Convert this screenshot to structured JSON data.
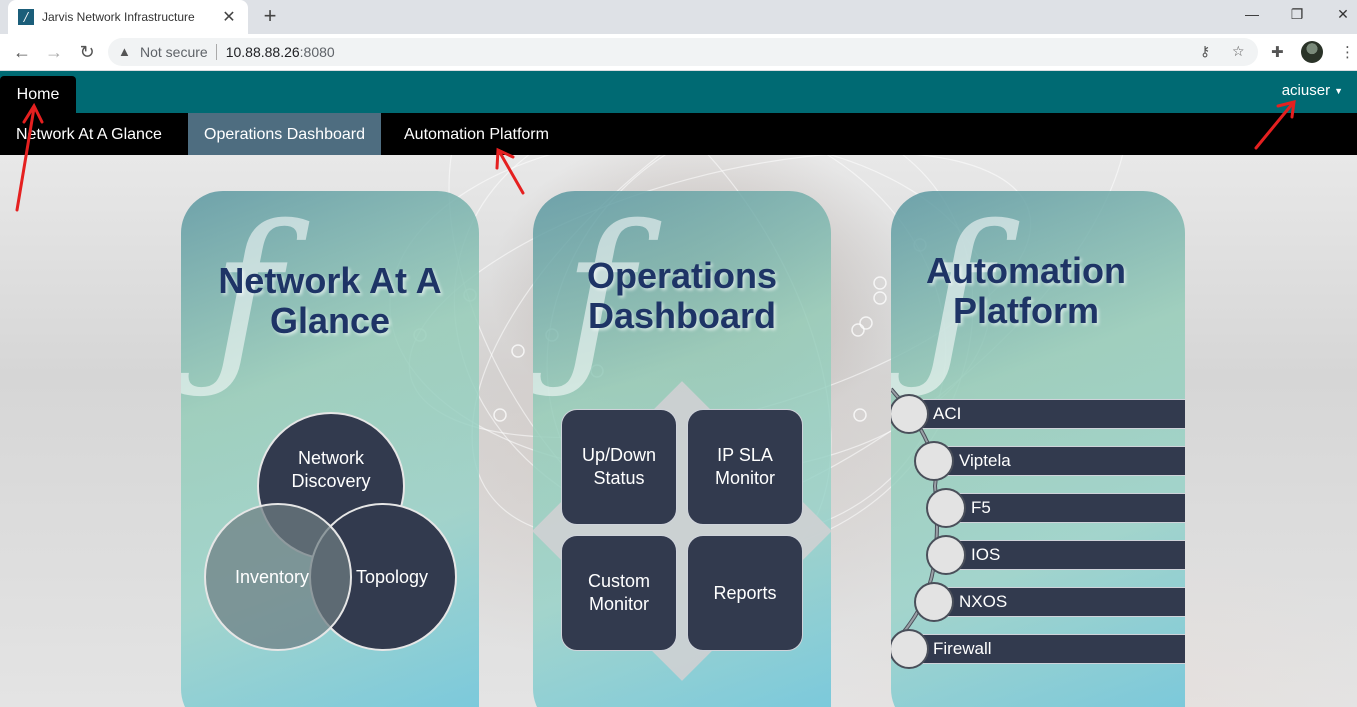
{
  "browser": {
    "tab_title": "Jarvis Network Infrastructure",
    "tab_close": "✕",
    "new_tab": "+",
    "security_label": "Not secure",
    "url_host": "10.88.88.26",
    "url_port": ":8080",
    "window_controls": {
      "minimize": "—",
      "maximize": "❐",
      "close": "✕"
    },
    "icons": [
      "back-arrow-icon",
      "forward-arrow-icon",
      "reload-icon",
      "warning-icon",
      "key-icon",
      "star-icon",
      "extensions-icon",
      "profile-avatar",
      "more-icon"
    ]
  },
  "app": {
    "home_tab": "Home",
    "user_menu": "aciuser",
    "nav": [
      {
        "label": "Network At A Glance"
      },
      {
        "label": "Operations Dashboard"
      },
      {
        "label": "Automation Platform"
      }
    ],
    "colors": {
      "header_teal": "#006a73",
      "nav_black": "#000000",
      "nav_active": "#4e6d80",
      "tile_navy": "#323a4e",
      "title_navy": "#1e3466"
    }
  },
  "cards": {
    "network": {
      "title_line1": "Network At A",
      "title_line2": "Glance",
      "venn": {
        "discovery_l1": "Network",
        "discovery_l2": "Discovery",
        "inventory": "Inventory",
        "topology": "Topology"
      }
    },
    "operations": {
      "title_line1": "Operations",
      "title_line2": "Dashboard",
      "tiles": {
        "updown_l1": "Up/Down",
        "updown_l2": "Status",
        "ipsla_l1": "IP SLA",
        "ipsla_l2": "Monitor",
        "custom_l1": "Custom",
        "custom_l2": "Monitor",
        "reports": "Reports"
      }
    },
    "automation": {
      "title_line1": "Automation",
      "title_line2": "Platform",
      "items": [
        {
          "label": "ACI"
        },
        {
          "label": "Viptela"
        },
        {
          "label": "F5"
        },
        {
          "label": "IOS"
        },
        {
          "label": "NXOS"
        },
        {
          "label": "Firewall"
        }
      ]
    }
  },
  "annotation": {
    "arrow_color": "#e52020"
  }
}
